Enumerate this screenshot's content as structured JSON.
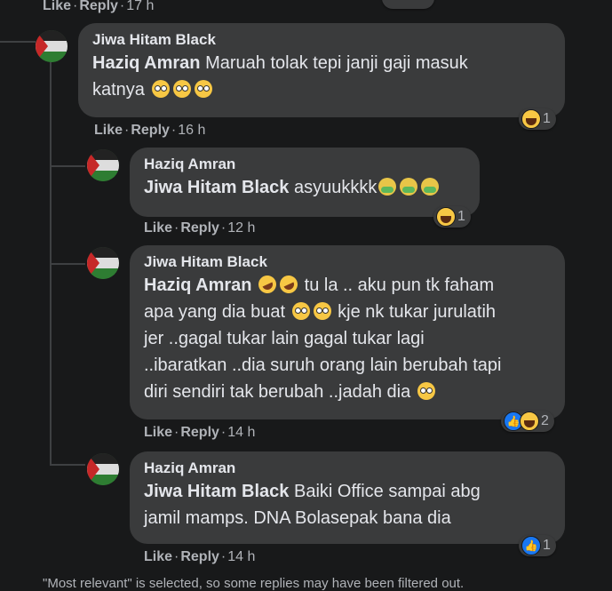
{
  "top_meta": {
    "like": "Like",
    "reply": "Reply",
    "time": "17 h"
  },
  "comments": [
    {
      "author": "Jiwa Hitam Black",
      "mention": "Haziq Amran",
      "text1": "Maruah tolak tepi janji gaji masuk",
      "text2": "katnya",
      "reaction_count": "1",
      "like": "Like",
      "reply": "Reply",
      "time": "16 h"
    },
    {
      "author": "Haziq Amran",
      "mention": "Jiwa Hitam Black",
      "text1": "asyuukkkk",
      "reaction_count": "1",
      "like": "Like",
      "reply": "Reply",
      "time": "12 h"
    },
    {
      "author": "Jiwa Hitam Black",
      "mention": "Haziq Amran",
      "text1": "tu la .. aku pun tk faham",
      "text2": "apa yang dia buat",
      "text2b": "kje nk tukar jurulatih",
      "text3": "jer ..gagal tukar lain gagal tukar lagi",
      "text4": "..ibaratkan ..dia suruh orang lain berubah tapi",
      "text5": "diri sendiri tak berubah ..jadah dia",
      "reaction_count": "2",
      "like": "Like",
      "reply": "Reply",
      "time": "14 h"
    },
    {
      "author": "Haziq Amran",
      "mention": "Jiwa Hitam Black",
      "text1": "Baiki Office sampai abg",
      "text2": "jamil mamps. DNA Bolasepak bana dia",
      "reaction_count": "1",
      "like": "Like",
      "reply": "Reply",
      "time": "14 h"
    }
  ],
  "footer": "\"Most relevant\" is selected, so some replies may have been filtered out.",
  "colors": {
    "background": "#18191a",
    "bubble": "#3a3b3c",
    "text": "#e4e6eb",
    "muted": "#b0b3b8",
    "like_blue": "#1877f2"
  }
}
